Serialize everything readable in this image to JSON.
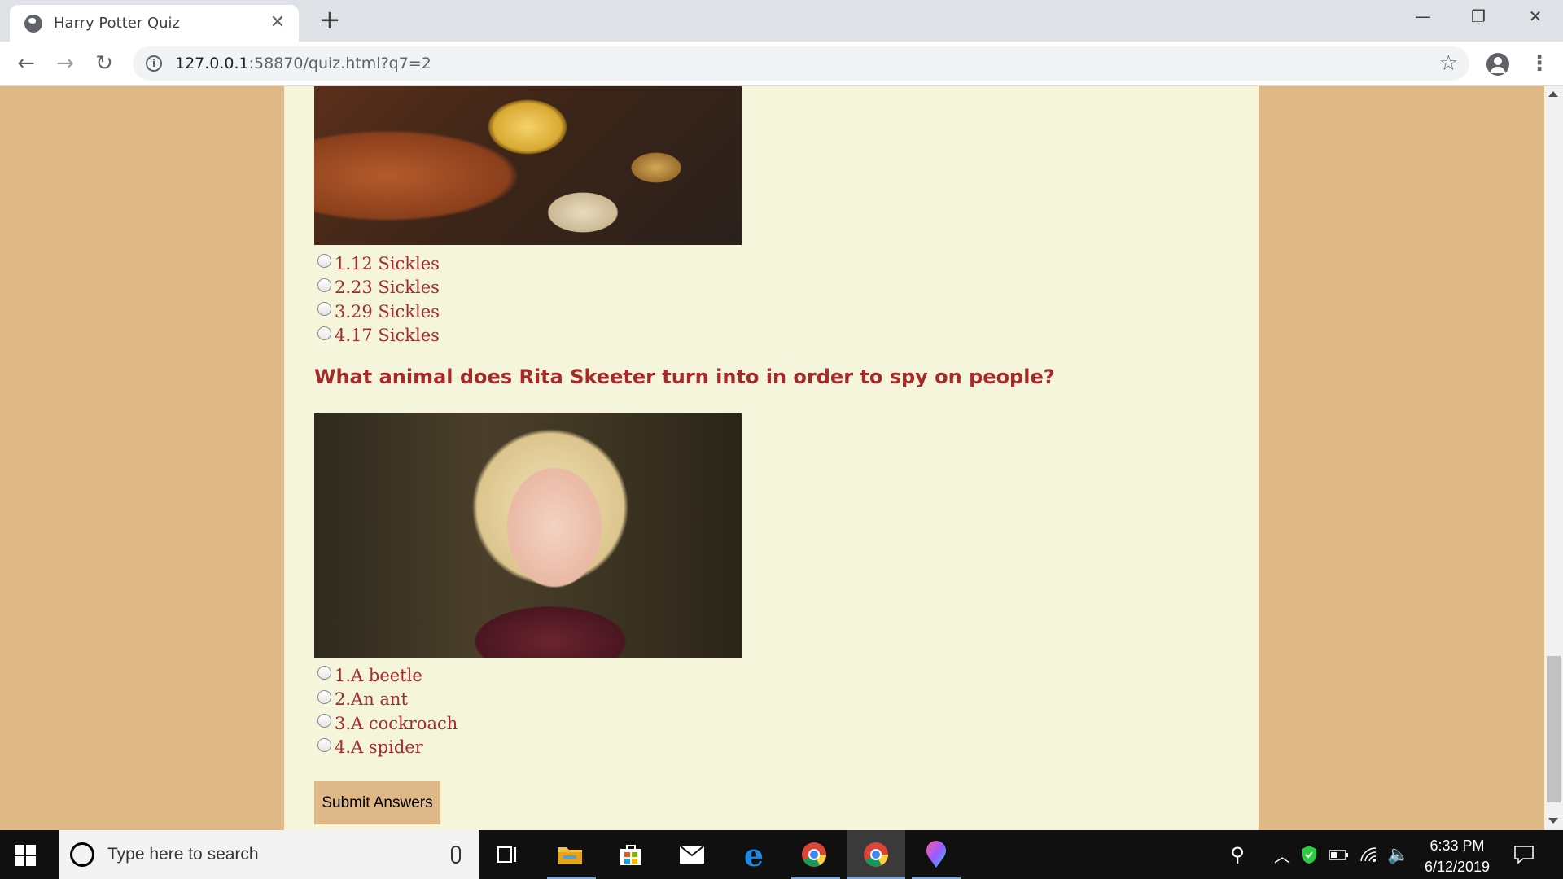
{
  "browser": {
    "tab_title": "Harry Potter Quiz",
    "tab_close": "✕",
    "new_tab": "+",
    "url_host": "127.0.0.1",
    "url_rest": ":58870/quiz.html?q7=2",
    "window_controls": {
      "minimize": "—",
      "restore": "❐",
      "close": "✕"
    },
    "icons": {
      "back": "←",
      "forward": "→",
      "reload": "↻",
      "info": "i",
      "star": "☆",
      "menu": "⋮"
    }
  },
  "quiz": {
    "question_prev": {
      "image_alt": "Wizard coins on a Gringotts bag",
      "options": [
        "1.12 Sickles",
        "2.23 Sickles",
        "3.29 Sickles",
        "4.17 Sickles"
      ]
    },
    "question_current": {
      "title": "What animal does Rita Skeeter turn into in order to spy on people?",
      "image_alt": "Rita Skeeter with glasses",
      "options": [
        "1.A beetle",
        "2.An ant",
        "3.A cockroach",
        "4.A spider"
      ]
    },
    "submit_label": "Submit Answers"
  },
  "taskbar": {
    "search_placeholder": "Type here to search",
    "time": "6:33 PM",
    "date": "6/12/2019",
    "tray_icons": [
      "people-icon",
      "chevron-up-icon",
      "shield-icon",
      "battery-icon",
      "wifi-icon",
      "volume-icon"
    ],
    "pinned": [
      "task-view-icon",
      "file-explorer-icon",
      "store-icon",
      "mail-icon",
      "edge-icon",
      "chrome-icon",
      "chrome-active-icon",
      "maps-icon"
    ]
  },
  "colors": {
    "page_bg": "#deb887",
    "content_bg": "#f5f5dc",
    "text": "#a52a2a"
  }
}
